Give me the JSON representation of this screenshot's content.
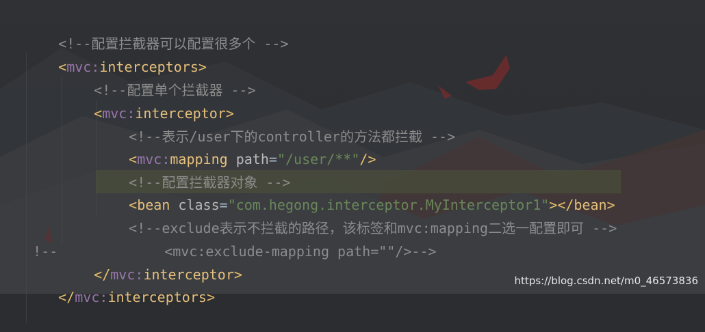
{
  "code": {
    "line1": "<!--配置拦截器可以配置很多个 -->",
    "l2_open": "<",
    "l2_ns": "mvc:",
    "l2_tag": "interceptors",
    "l2_close": ">",
    "line3": "<!--配置单个拦截器 -->",
    "l4_open": "<",
    "l4_ns": "mvc:",
    "l4_tag": "interceptor",
    "l4_close": ">",
    "line5": "<!--表示/user下的controller的方法都拦截 -->",
    "l6_open": "<",
    "l6_ns": "mvc:",
    "l6_tag": "mapping",
    "l6_attr": " path",
    "l6_eq": "=",
    "l6_val": "\"/user/**\"",
    "l6_close": "/>",
    "line7": "<!--配置拦截器对象 -->",
    "l8_open": "<",
    "l8_tag": "bean",
    "l8_attr": " class",
    "l8_eq": "=",
    "l8_val": "\"com.hegong.interceptor.MyInterceptor1\"",
    "l8_mid": "></",
    "l8_tag2": "bean",
    "l8_close": ">",
    "line9": "<!--exclude表示不拦截的路径，该标签和mvc:mapping二选一配置即可 -->",
    "line10_prefix": "!--",
    "line10": "<mvc:exclude-mapping path=\"\"/>-->",
    "l11_open": "</",
    "l11_ns": "mvc:",
    "l11_tag": "interceptor",
    "l11_close": ">",
    "l12_open": "</",
    "l12_ns": "mvc:",
    "l12_tag": "interceptors",
    "l12_close": ">"
  },
  "watermark": "https://blog.csdn.net/m0_46573836"
}
